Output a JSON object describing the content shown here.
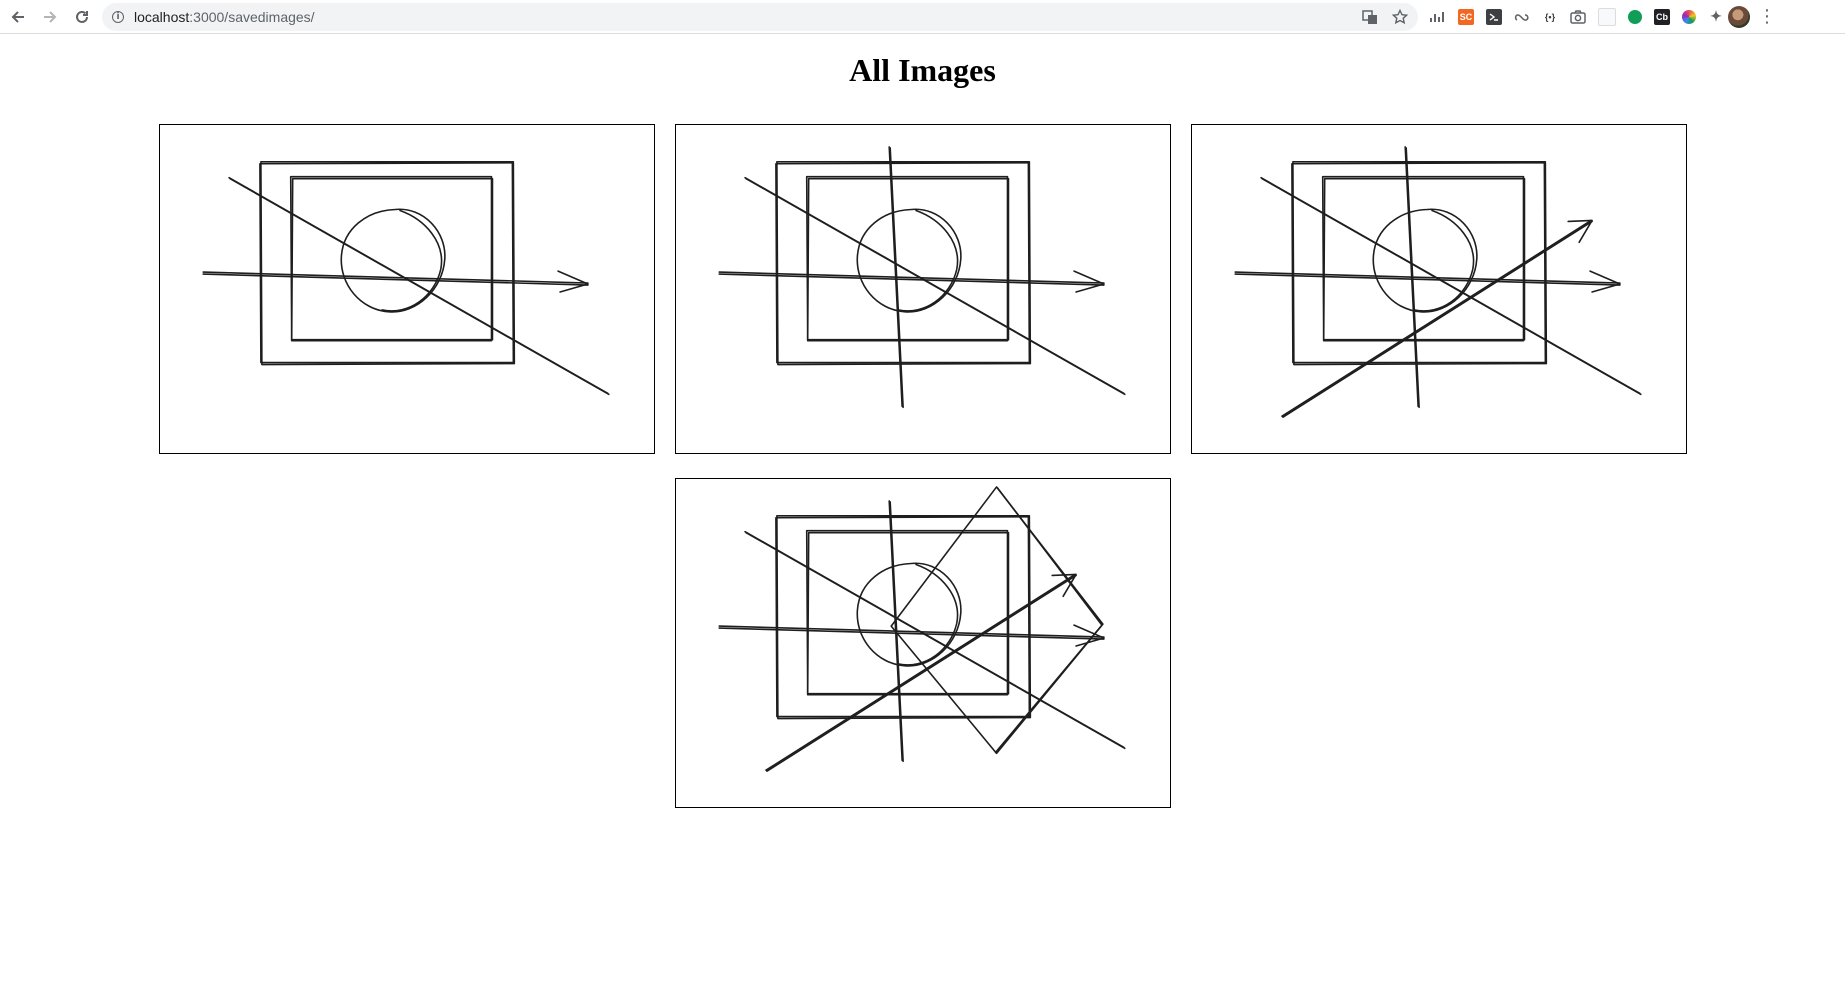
{
  "browser": {
    "url_host": "localhost",
    "url_rest": ":3000/savedimages/",
    "extensions": [
      {
        "icon": "chart-bars-icon",
        "label": "",
        "color": "#5f6368"
      },
      {
        "icon": "sc-icon",
        "label": "SC",
        "color": "#f26722"
      },
      {
        "icon": "terminal-icon",
        "label": "",
        "color": "#3c4043"
      },
      {
        "icon": "infinity-link-icon",
        "label": "",
        "color": "#5f6368"
      },
      {
        "icon": "braces-icon",
        "label": "{•}",
        "color": "#5f6368"
      },
      {
        "icon": "camera-icon",
        "label": "",
        "color": "#5f6368"
      },
      {
        "icon": "blank-page-icon",
        "label": "",
        "color": "#dadce0"
      },
      {
        "icon": "green-drop-icon",
        "label": "",
        "color": "#0f9d58"
      },
      {
        "icon": "cb-icon",
        "label": "Cb",
        "color": "#202124"
      },
      {
        "icon": "color-wheel-icon",
        "label": "",
        "color": "#e84a5f"
      },
      {
        "icon": "puzzle-icon",
        "label": "",
        "color": "#5f6368"
      }
    ]
  },
  "page": {
    "title": "All Images"
  },
  "images": [
    {
      "layers": [
        "frame",
        "inner",
        "circle",
        "arrow",
        "diag"
      ]
    },
    {
      "layers": [
        "frame",
        "inner",
        "circle",
        "arrow",
        "diag",
        "vert"
      ]
    },
    {
      "layers": [
        "frame",
        "inner",
        "circle",
        "arrow",
        "diag",
        "vert",
        "arrow2"
      ]
    },
    {
      "layers": [
        "frame",
        "inner",
        "circle",
        "arrow",
        "diag",
        "vert",
        "arrow2",
        "diamond"
      ]
    }
  ]
}
